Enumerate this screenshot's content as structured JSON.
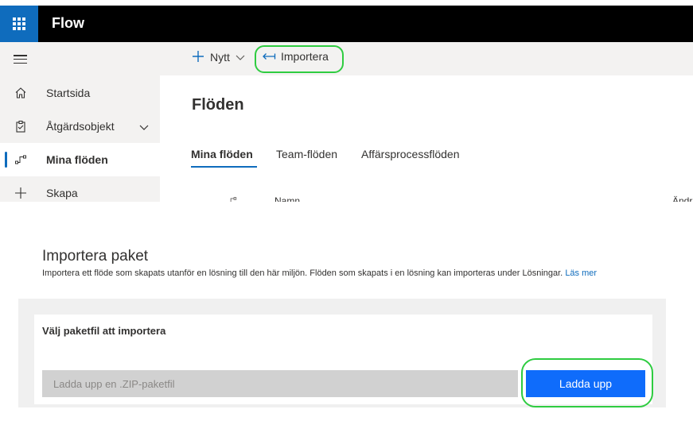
{
  "app": {
    "title": "Flow"
  },
  "sidebar": {
    "items": [
      {
        "label": "Startsida",
        "icon": "home-icon"
      },
      {
        "label": "Åtgärdsobjekt",
        "icon": "clipboard-icon"
      },
      {
        "label": "Mina flöden",
        "icon": "flow-icon"
      },
      {
        "label": "Skapa",
        "icon": "plus-icon"
      }
    ]
  },
  "commandbar": {
    "new_label": "Nytt",
    "import_label": "Importera"
  },
  "main": {
    "title": "Flöden",
    "tabs": [
      "Mina flöden",
      "Team-flöden",
      "Affärsprocessflöden"
    ],
    "columns": {
      "name": "Namn",
      "modified": "Ändr"
    }
  },
  "import": {
    "title": "Importera paket",
    "description": "Importera ett flöde som skapats utanför en lösning till den här miljön. Flöden som skapats i en lösning kan importeras under Lösningar.",
    "learn_more": "Läs mer",
    "card_title": "Välj paketfil att importera",
    "file_placeholder": "Ladda upp en .ZIP-paketfil",
    "upload_label": "Ladda upp"
  },
  "colors": {
    "accent": "#0f6cbd",
    "upload_button": "#0f6cfb",
    "highlight": "#2ecc40"
  }
}
